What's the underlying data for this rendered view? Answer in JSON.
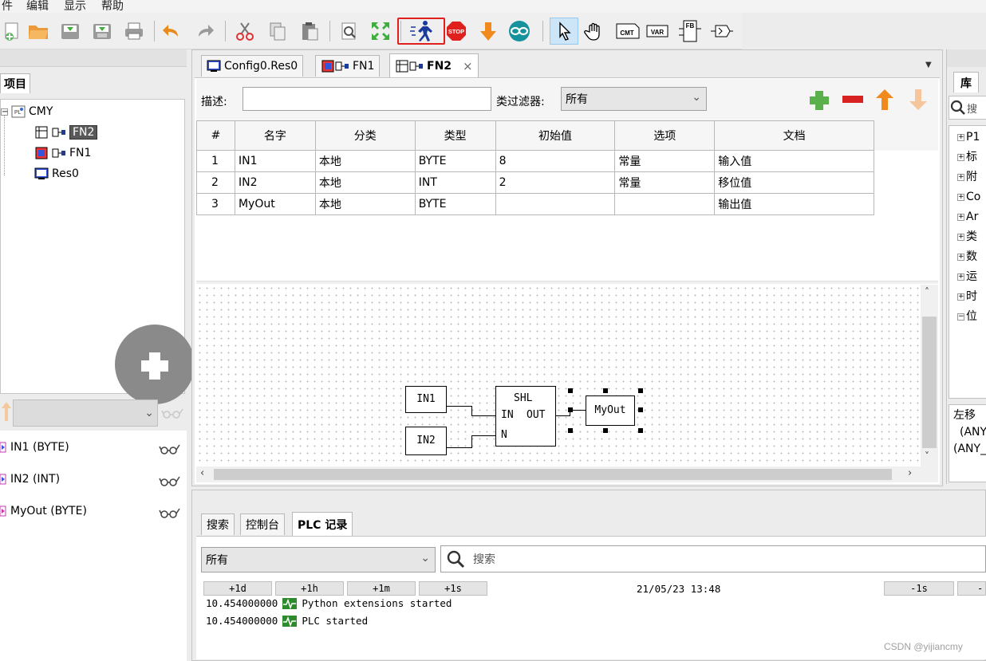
{
  "menu": [
    "件",
    "编辑",
    "显示",
    "帮助"
  ],
  "toolbar": {
    "icons": [
      "new-file-icon",
      "open-folder-icon",
      "save-icon",
      "save-as-icon",
      "print-icon",
      "undo-icon",
      "redo-icon",
      "cut-icon",
      "copy-icon",
      "paste-icon",
      "search-zoom-icon",
      "fullscreen-icon",
      "run-icon",
      "stop-icon",
      "download-icon",
      "arduino-icon",
      "pointer-icon",
      "hand-icon",
      "comment-icon",
      "variable-icon",
      "function-block-icon",
      "connector-icon"
    ],
    "tool_labels": {
      "cmt": "CMT",
      "var": "VAR",
      "fb": "FB",
      "stop": "STOP"
    }
  },
  "left": {
    "project_tab": "项目",
    "tree": {
      "root": "CMY",
      "items": [
        {
          "label": "FN2",
          "selected": true
        },
        {
          "label": "FN1",
          "selected": false
        },
        {
          "label": "Res0",
          "selected": false
        }
      ]
    },
    "var_list": [
      {
        "label": "IN1 (BYTE)"
      },
      {
        "label": "IN2 (INT)"
      },
      {
        "label": "MyOut (BYTE)"
      }
    ]
  },
  "editor": {
    "tabs": [
      {
        "label": "Config0.Res0",
        "active": false
      },
      {
        "label": "FN1",
        "active": false
      },
      {
        "label": "FN2",
        "active": true
      }
    ],
    "desc_label": "描述:",
    "desc_value": "",
    "filter_label": "类过滤器:",
    "filter_value": "所有",
    "columns": [
      "#",
      "名字",
      "分类",
      "类型",
      "初始值",
      "选项",
      "文档"
    ],
    "rows": [
      [
        "1",
        "IN1",
        "本地",
        "BYTE",
        "8",
        "常量",
        "输入值"
      ],
      [
        "2",
        "IN2",
        "本地",
        "INT",
        "2",
        "常量",
        "移位值"
      ],
      [
        "3",
        "MyOut",
        "本地",
        "BYTE",
        "",
        "",
        "输出值"
      ]
    ],
    "diagram": {
      "in1": "IN1",
      "in2": "IN2",
      "block_name": "SHL",
      "pin_in": "IN",
      "pin_out": "OUT",
      "pin_n": "N",
      "out": "MyOut"
    }
  },
  "right": {
    "tab": "库",
    "search_hint": "搜",
    "tree": [
      "P1",
      "标",
      "附",
      "Co",
      "Ar",
      "类",
      "数",
      "运",
      "时",
      "位"
    ],
    "desc_lines": [
      "左移",
      "(ANY_",
      "(ANY_"
    ]
  },
  "bottom": {
    "tabs": [
      {
        "label": "搜索",
        "active": false
      },
      {
        "label": "控制台",
        "active": false
      },
      {
        "label": "PLC 记录",
        "active": true
      }
    ],
    "level_value": "所有",
    "search_placeholder": "搜索",
    "time_buttons": [
      "+1d",
      "+1h",
      "+1m",
      "+1s"
    ],
    "timestamp": "21/05/23 13:48",
    "right_buttons": [
      "-1s",
      "-"
    ],
    "log": [
      {
        "time": "10.454000000",
        "msg": "Python extensions started"
      },
      {
        "time": "10.454000000",
        "msg": "PLC started"
      }
    ]
  },
  "watermark": "CSDN @yijiancmy",
  "colors": {
    "accent_selected": "#3c3c3c",
    "run_highlight": "#e0201c",
    "tree_selected_bg": "#595959"
  }
}
